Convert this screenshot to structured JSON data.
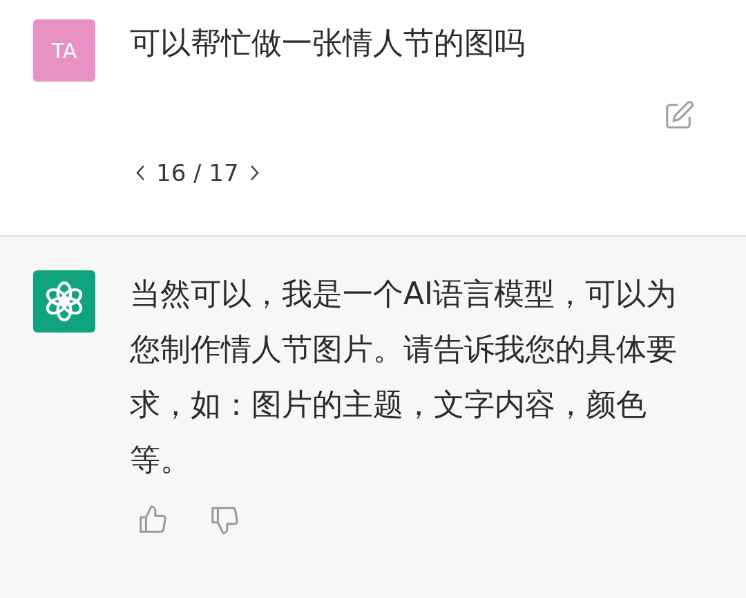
{
  "messages": [
    {
      "kind": "user",
      "avatar": "TA",
      "text": "可以帮忙做一张情人节的图吗",
      "pagination": "16 / 17"
    },
    {
      "kind": "assistant",
      "text": "当然可以，我是一个AI语言模型，可以为您制作情人节图片。请告诉我您的具体要求，如：图片的主题，文字内容，颜色等。"
    }
  ]
}
